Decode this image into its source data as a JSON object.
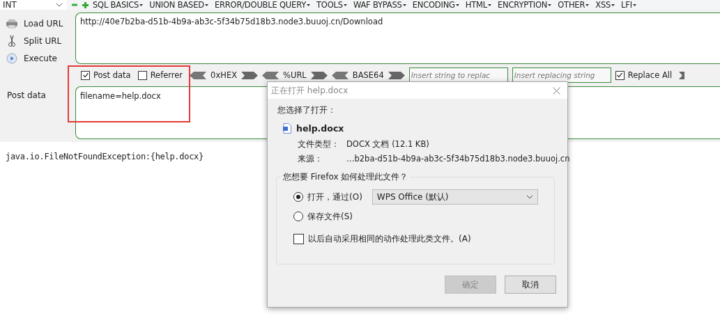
{
  "menu_bar": {
    "dropdown": {
      "value": "INT"
    },
    "items": [
      {
        "label": "SQL BASICS"
      },
      {
        "label": "UNION BASED"
      },
      {
        "label": "ERROR/DOUBLE QUERY"
      },
      {
        "label": "TOOLS"
      },
      {
        "label": "WAF BYPASS"
      },
      {
        "label": "ENCODING"
      },
      {
        "label": "HTML"
      },
      {
        "label": "ENCRYPTION"
      },
      {
        "label": "OTHER"
      },
      {
        "label": "XSS"
      },
      {
        "label": "LFI"
      }
    ]
  },
  "actions": [
    {
      "kind": "load",
      "label": "Load URL"
    },
    {
      "kind": "split",
      "label": "Split URL"
    },
    {
      "kind": "execute",
      "label": "Execute"
    }
  ],
  "url_field": {
    "value": "http://40e7b2ba-d51b-4b9a-ab3c-5f34b75d18b3.node3.buuoj.cn/Download"
  },
  "toolbar": {
    "checkboxes": [
      {
        "label": "Post data",
        "checked": true
      },
      {
        "label": "Referrer",
        "checked": false
      }
    ],
    "encoders": [
      {
        "label": "0xHEX"
      },
      {
        "label": "%URL"
      },
      {
        "label": "BASE64"
      }
    ],
    "replace_fields": [
      {
        "placeholder": "Insert string to replac"
      },
      {
        "placeholder": "Insert replacing string"
      }
    ],
    "replace_all": {
      "label": "Replace All",
      "checked": true
    }
  },
  "post_data": {
    "label": "Post data",
    "value": "filename=help.docx"
  },
  "result": "java.io.FileNotFoundException:{help.docx}",
  "dialog": {
    "title": "正在打开 help.docx",
    "prompt": "您选择了打开：",
    "file_name": "help.docx",
    "details": [
      {
        "label": "文件类型：",
        "value": "DOCX 文档 (12.1 KB)"
      },
      {
        "label": "来源：",
        "value": "…b2ba-d51b-4b9a-ab3c-5f34b75d18b3.node3.buuoj.cn"
      }
    ],
    "question": "您想要 Firefox 如何处理此文件？",
    "options": [
      {
        "label": "打开，通过(O)",
        "selected": true,
        "app": "WPS Office (默认)"
      },
      {
        "label": "保存文件(S)",
        "selected": false
      }
    ],
    "remember": {
      "label": "以后自动采用相同的动作处理此类文件。(A)",
      "checked": false
    },
    "buttons": [
      {
        "label": "确定",
        "disabled": true
      },
      {
        "label": "取消",
        "disabled": false
      }
    ]
  }
}
